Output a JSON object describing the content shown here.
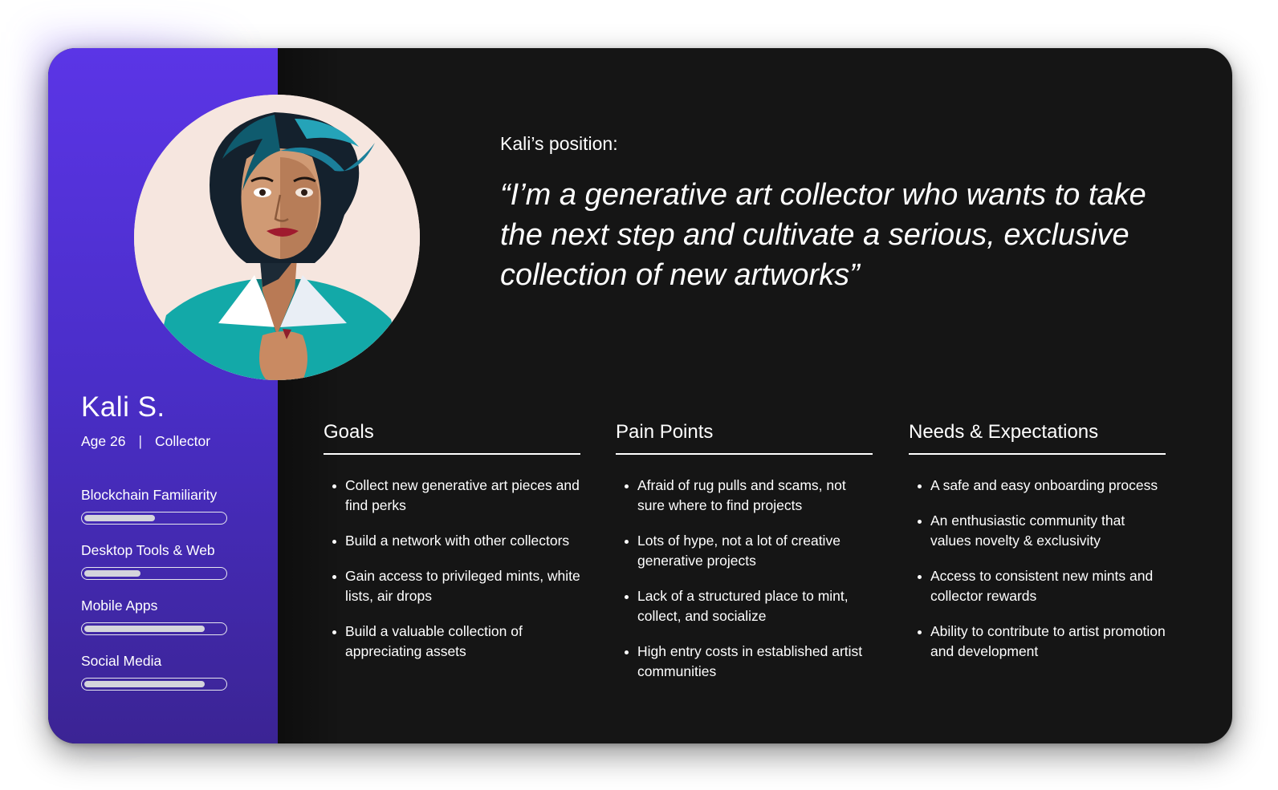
{
  "persona": {
    "name": "Kali S.",
    "age": "Age 26",
    "role": "Collector",
    "separator": "|",
    "avatar_icon": "woman-portrait-icon"
  },
  "skills": [
    {
      "label": "Blockchain Familiarity",
      "level": 0.5
    },
    {
      "label": "Desktop Tools & Web",
      "level": 0.4
    },
    {
      "label": "Mobile Apps",
      "level": 0.85
    },
    {
      "label": "Social Media",
      "level": 0.85
    }
  ],
  "position": {
    "label": "Kali’s position:",
    "quote": "“I’m a generative art collector who wants to take the next step and cultivate a serious, exclusive collection of new artworks”"
  },
  "sections": [
    {
      "title": "Goals",
      "items": [
        "Collect new generative art pieces and find perks",
        "Build a network with other collectors",
        "Gain access to privileged mints, white lists, air drops",
        "Build a valuable collection of appreciating assets"
      ]
    },
    {
      "title": "Pain Points",
      "items": [
        "Afraid of rug pulls and scams, not sure where to find projects",
        "Lots of hype, not a lot of creative generative projects",
        "Lack of a structured place to mint, collect, and socialize",
        "High entry costs in established artist communities"
      ]
    },
    {
      "title": "Needs & Expectations",
      "items": [
        "A safe and easy onboarding process",
        "An enthusiastic community that values novelty & exclusivity",
        "Access to consistent new mints and collector rewards",
        "Ability to contribute to artist promotion and development"
      ]
    }
  ],
  "colors": {
    "sidebar_top": "#5b35e6",
    "sidebar_bottom": "#3b2494",
    "panel_bg": "#151515",
    "text": "#ffffff"
  }
}
